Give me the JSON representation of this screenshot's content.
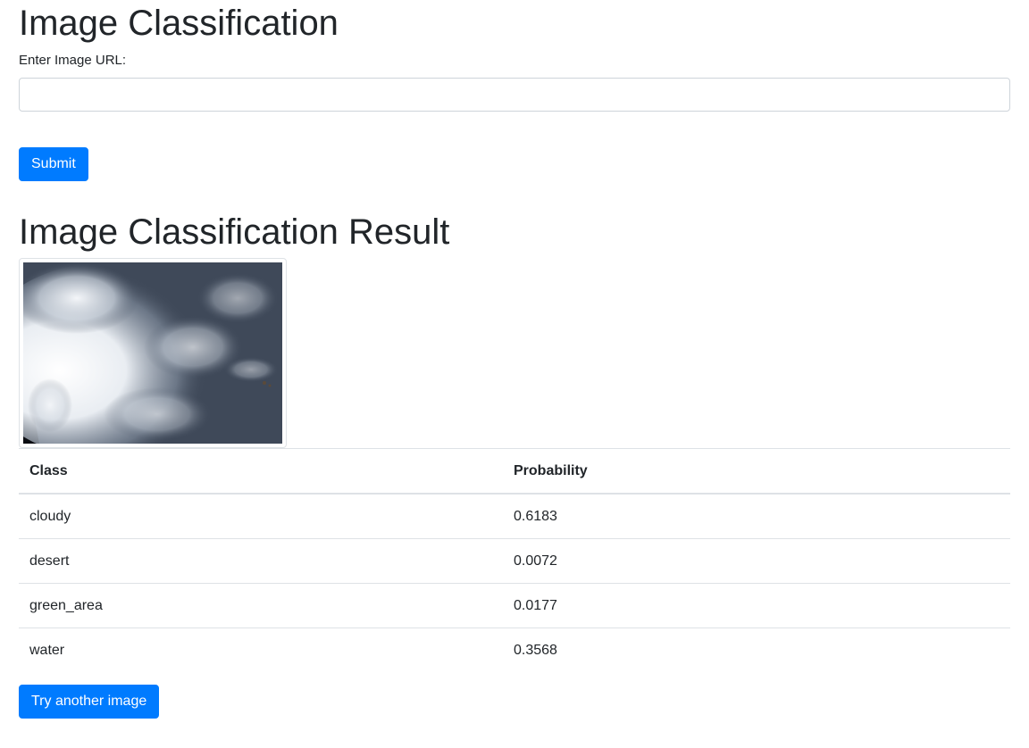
{
  "form": {
    "title": "Image Classification",
    "url_label": "Enter Image URL:",
    "url_value": "",
    "url_placeholder": "",
    "submit_label": "Submit"
  },
  "result": {
    "title": "Image Classification Result",
    "table": {
      "headers": [
        "Class",
        "Probability"
      ],
      "rows": [
        {
          "class": "cloudy",
          "probability": "0.6183"
        },
        {
          "class": "desert",
          "probability": "0.0072"
        },
        {
          "class": "green_area",
          "probability": "0.0177"
        },
        {
          "class": "water",
          "probability": "0.3568"
        }
      ]
    },
    "again_label": "Try another image"
  },
  "colors": {
    "primary": "#007bff",
    "text": "#212529",
    "border": "#dee2e6"
  }
}
